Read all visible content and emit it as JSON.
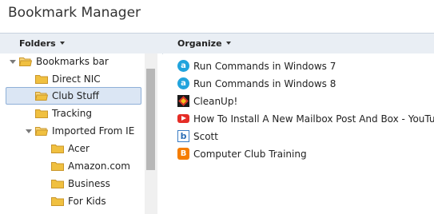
{
  "window": {
    "title": "Bookmark Manager"
  },
  "header": {
    "folders_label": "Folders",
    "organize_label": "Organize"
  },
  "tree": {
    "items": [
      {
        "label": "Bookmarks bar"
      },
      {
        "label": "Direct NIC"
      },
      {
        "label": "Club Stuff"
      },
      {
        "label": "Tracking"
      },
      {
        "label": "Imported From IE"
      },
      {
        "label": "Acer"
      },
      {
        "label": "Amazon.com"
      },
      {
        "label": "Business"
      },
      {
        "label": "For Kids"
      }
    ]
  },
  "bookmarks": {
    "items": [
      {
        "title": "Run Commands in Windows 7",
        "icon": "about-icon"
      },
      {
        "title": "Run Commands in Windows 8",
        "icon": "about-icon"
      },
      {
        "title": "CleanUp!",
        "icon": "cleanup-icon"
      },
      {
        "title": "How To Install A New Mailbox Post And Box - YouTube",
        "icon": "youtube-icon"
      },
      {
        "title": "Scott",
        "icon": "b-icon"
      },
      {
        "title": "Computer Club Training",
        "icon": "blogger-icon"
      }
    ]
  },
  "colors": {
    "selection_bg": "#dbe6f4",
    "selection_border": "#8fb0d8",
    "header_bg": "#e9eef4",
    "folder": "#f0c040"
  }
}
